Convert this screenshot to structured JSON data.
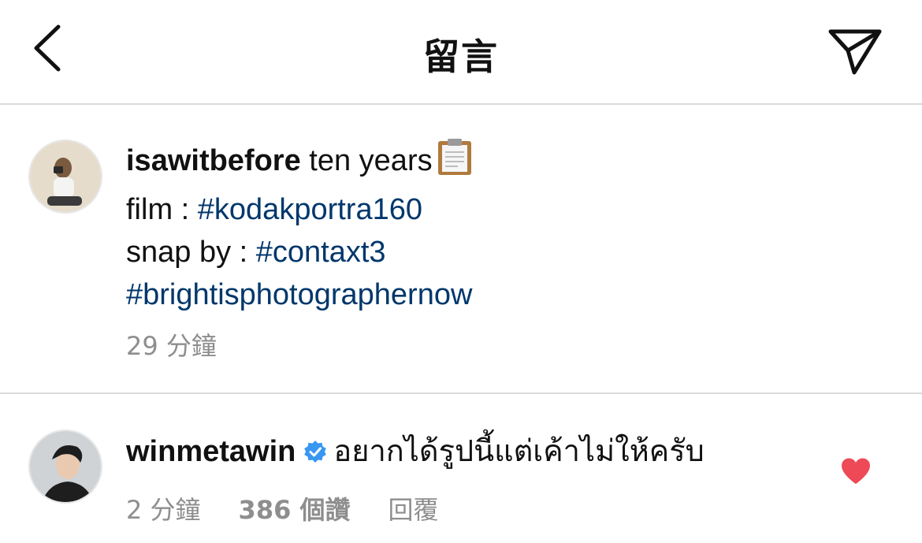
{
  "header": {
    "title": "留言",
    "back_icon": "chevron-left-icon",
    "share_icon": "paper-plane-icon"
  },
  "post": {
    "username": "isawitbefore",
    "caption_line1_text": " ten years",
    "caption_line1_emoji": "clipboard-icon",
    "caption_line2_prefix": "film : ",
    "caption_line2_hashtag": "#kodakportra160",
    "caption_line3_prefix": "snap by : ",
    "caption_line3_hashtag": "#contaxt3",
    "caption_line4_hashtag": "#brightisphotographernow",
    "time": "29 分鐘"
  },
  "comment": {
    "username": "winmetawin",
    "verified": true,
    "text": "อยากได้รูปนี้แต่เค้าไม่ให้ครับ",
    "time": "2 分鐘",
    "likes": "386 個讚",
    "reply_label": "回覆",
    "liked": true
  },
  "colors": {
    "hashtag": "#00376b",
    "meta": "#8e8e8e",
    "verified": "#3897f0",
    "heart": "#ed4956",
    "divider": "#dbdbdb"
  }
}
